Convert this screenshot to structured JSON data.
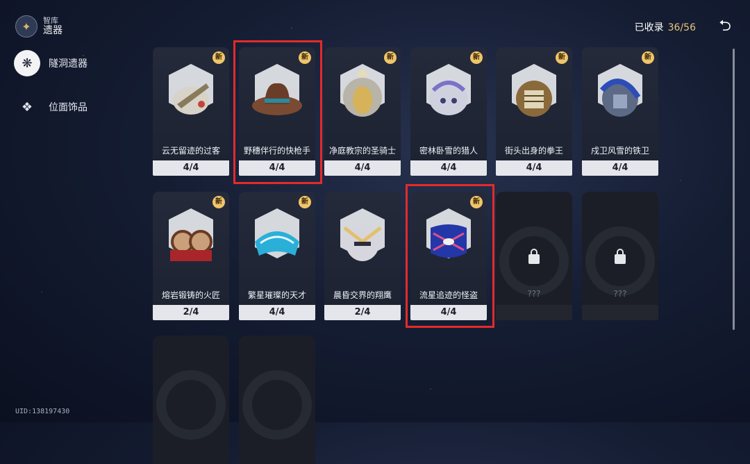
{
  "header": {
    "small": "智库",
    "big": "遗器",
    "icon": "relic-box-icon"
  },
  "sidebar": {
    "items": [
      {
        "label": "隧洞遗器",
        "icon": "cavern-relic-icon",
        "active": true
      },
      {
        "label": "位面饰品",
        "icon": "planar-ornament-icon",
        "active": false
      }
    ]
  },
  "collection": {
    "label": "已收录",
    "value": "36/56"
  },
  "uid": "UID:138197430",
  "badge_text": "新",
  "cards": [
    {
      "name": "云无留迹的过客",
      "count": "4/4",
      "new": true,
      "art": "hat-feather"
    },
    {
      "name": "野穗伴行的快枪手",
      "count": "4/4",
      "new": true,
      "art": "cowboy-hat"
    },
    {
      "name": "净庭教宗的圣骑士",
      "count": "4/4",
      "new": true,
      "art": "knight-mask"
    },
    {
      "name": "密林卧雪的猎人",
      "count": "4/4",
      "new": true,
      "art": "beast-helm"
    },
    {
      "name": "街头出身的拳王",
      "count": "4/4",
      "new": true,
      "art": "boxer-helm"
    },
    {
      "name": "戍卫风雪的铁卫",
      "count": "4/4",
      "new": true,
      "art": "guard-helm"
    },
    {
      "name": "熔岩锻铸的火匠",
      "count": "2/4",
      "new": true,
      "art": "goggles"
    },
    {
      "name": "繁星璀璨的天才",
      "count": "4/4",
      "new": true,
      "art": "visor"
    },
    {
      "name": "晨昏交界的翔鹰",
      "count": "2/4",
      "new": false,
      "art": "eagle-mask"
    },
    {
      "name": "流星追迹的怪盗",
      "count": "4/4",
      "new": true,
      "art": "thief-mask"
    },
    {
      "name": "???",
      "count": "",
      "locked": true
    },
    {
      "name": "???",
      "count": "",
      "locked": true
    },
    {
      "name": "",
      "count": "",
      "locked": true
    },
    {
      "name": "",
      "count": "",
      "locked": true
    }
  ],
  "colors": {
    "accent": "#e8c57b",
    "highlight": "#e52a2a",
    "badge": "#f0c56a"
  }
}
